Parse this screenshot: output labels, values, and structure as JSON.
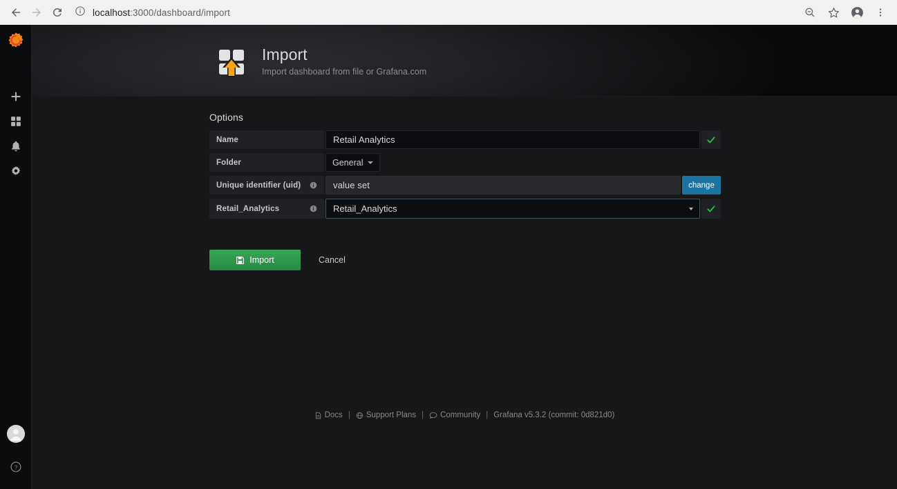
{
  "browser": {
    "url_host": "localhost",
    "url_path": ":3000/dashboard/import",
    "back_icon": "back-arrow-icon",
    "forward_icon": "forward-arrow-icon",
    "reload_icon": "reload-icon",
    "site_info_icon": "info-circle-icon",
    "zoom_icon": "search-zoom-icon",
    "bookmark_icon": "star-icon",
    "profile_icon": "account-avatar-icon",
    "menu_icon": "kebab-menu-icon"
  },
  "sidebar": {
    "logo": "grafana-logo-icon",
    "items": [
      {
        "name": "create",
        "icon": "plus-icon"
      },
      {
        "name": "dashboards",
        "icon": "grid-squares-icon"
      },
      {
        "name": "alerting",
        "icon": "bell-icon"
      },
      {
        "name": "configuration",
        "icon": "gear-icon"
      }
    ],
    "bottom": [
      {
        "name": "user-profile",
        "icon": "avatar-icon"
      },
      {
        "name": "help",
        "icon": "question-circle-icon"
      }
    ]
  },
  "header": {
    "icon": "import-dashboard-icon",
    "title": "Import",
    "subtitle": "Import dashboard from file or Grafana.com"
  },
  "form": {
    "section_title": "Options",
    "rows": [
      {
        "label": "Name",
        "type": "text",
        "value": "Retail Analytics",
        "has_info": false,
        "valid": true
      },
      {
        "label": "Folder",
        "type": "dropdown",
        "value": "General",
        "has_info": false,
        "valid": false
      },
      {
        "label": "Unique identifier (uid)",
        "type": "readonly",
        "value": "value set",
        "has_info": true,
        "action_label": "change"
      },
      {
        "label": "Retail_Analytics",
        "type": "select",
        "value": "Retail_Analytics",
        "has_info": true,
        "valid": true
      }
    ]
  },
  "actions": {
    "import_label": "Import",
    "import_icon": "save-floppy-icon",
    "cancel_label": "Cancel"
  },
  "footer": {
    "docs_label": "Docs",
    "docs_icon": "document-icon",
    "support_label": "Support Plans",
    "support_icon": "globe-icon",
    "community_label": "Community",
    "community_icon": "comment-icon",
    "version": "Grafana v5.3.2 (commit: 0d821d0)",
    "separator": "|"
  },
  "colors": {
    "accent_green": "#2bb24c",
    "check_green": "#20c040",
    "change_blue": "#1b73a0",
    "brand_orange": "#f2870d",
    "panel_bg": "#161719",
    "label_bg": "#1f2125"
  }
}
